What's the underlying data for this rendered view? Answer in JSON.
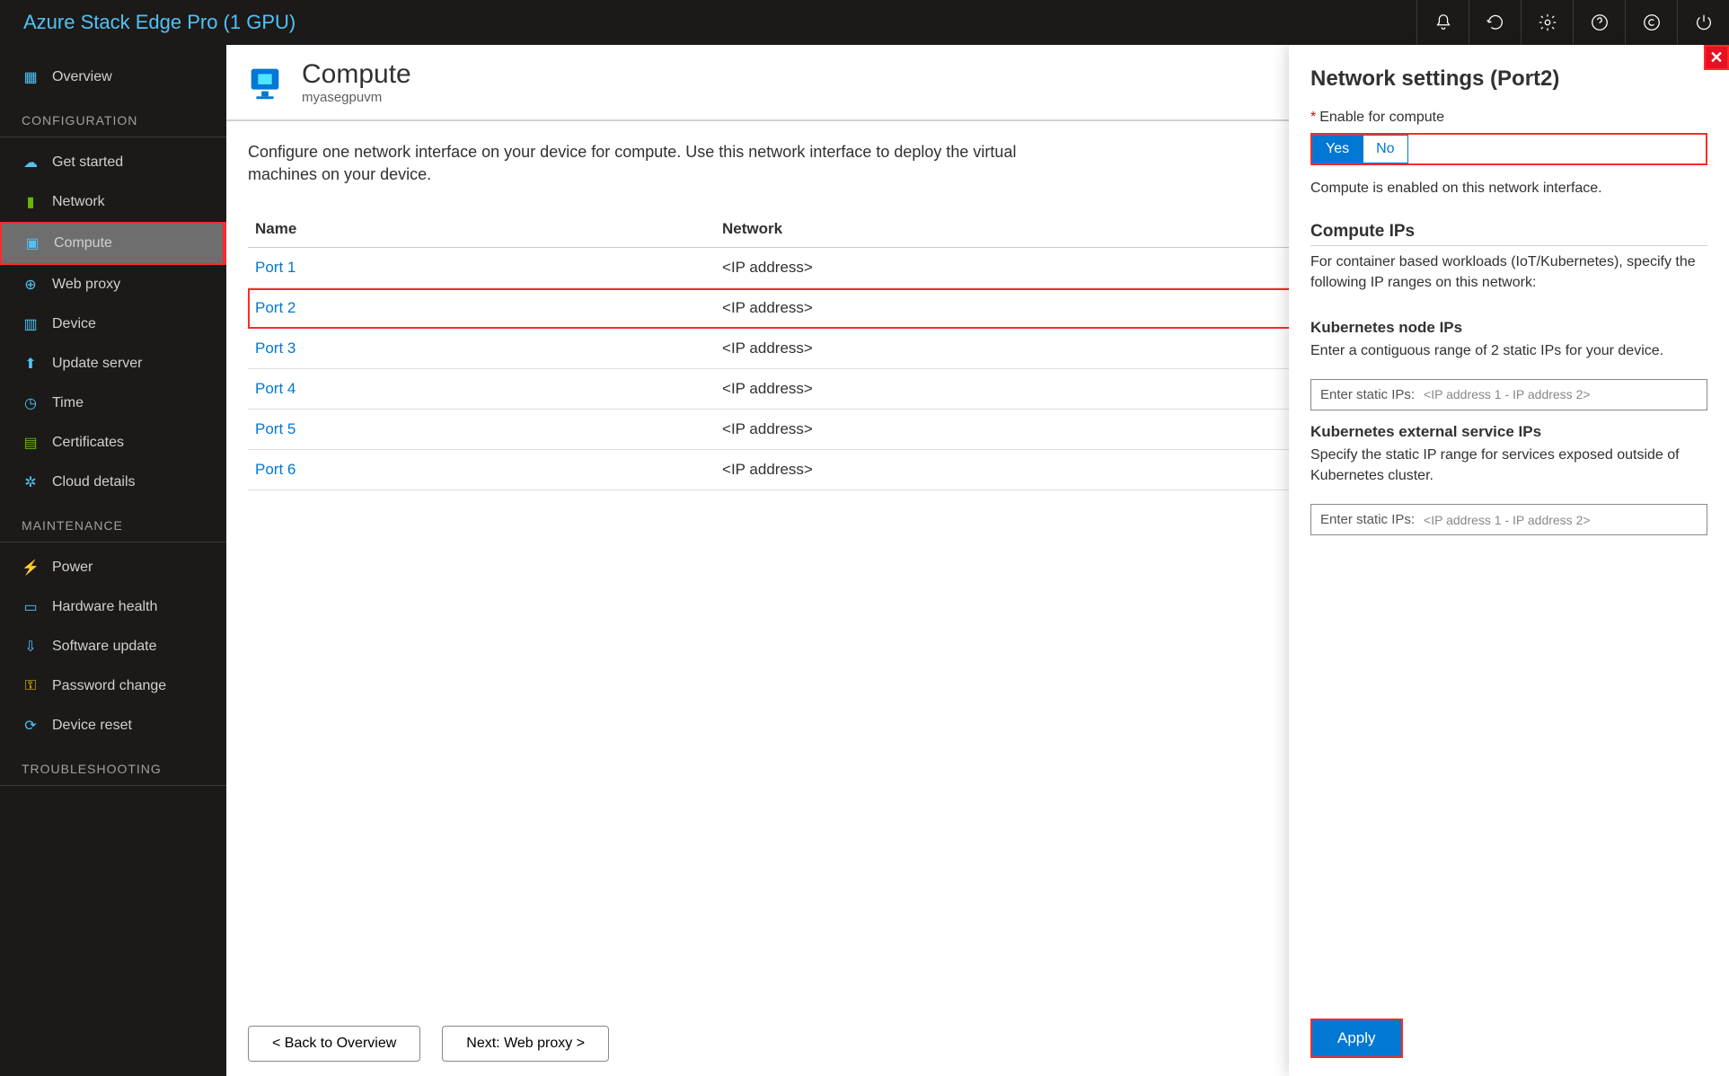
{
  "app_title": "Azure Stack Edge Pro (1 GPU)",
  "sidebar": {
    "overview": "Overview",
    "sections": {
      "config": {
        "label": "CONFIGURATION",
        "items": [
          {
            "label": "Get started"
          },
          {
            "label": "Network"
          },
          {
            "label": "Compute"
          },
          {
            "label": "Web proxy"
          },
          {
            "label": "Device"
          },
          {
            "label": "Update server"
          },
          {
            "label": "Time"
          },
          {
            "label": "Certificates"
          },
          {
            "label": "Cloud details"
          }
        ]
      },
      "maint": {
        "label": "MAINTENANCE",
        "items": [
          {
            "label": "Power"
          },
          {
            "label": "Hardware health"
          },
          {
            "label": "Software update"
          },
          {
            "label": "Password change"
          },
          {
            "label": "Device reset"
          }
        ]
      },
      "trouble": {
        "label": "TROUBLESHOOTING"
      }
    }
  },
  "page": {
    "title": "Compute",
    "subtitle": "myasegpuvm",
    "intro": "Configure one network interface on your device for compute. Use this network interface to deploy the virtual machines on your device.",
    "table": {
      "col_name": "Name",
      "col_network": "Network",
      "rows": [
        {
          "name": "Port 1",
          "net": "<IP address>"
        },
        {
          "name": "Port 2",
          "net": "<IP address>"
        },
        {
          "name": "Port 3",
          "net": "<IP address>"
        },
        {
          "name": "Port 4",
          "net": "<IP address>"
        },
        {
          "name": "Port 5",
          "net": "<IP address>"
        },
        {
          "name": "Port 6",
          "net": "<IP address>"
        }
      ]
    },
    "back_btn": "< Back to Overview",
    "next_btn": "Next: Web proxy >"
  },
  "panel": {
    "title": "Network settings (Port2)",
    "enable_label": "Enable for compute",
    "yes": "Yes",
    "no": "No",
    "enabled_text": "Compute is enabled on this network interface.",
    "compute_ips_h": "Compute IPs",
    "compute_ips_p": "For container based workloads (IoT/Kubernetes), specify the following IP ranges on this network:",
    "k8s_node_h": "Kubernetes node IPs",
    "k8s_node_p": "Enter a contiguous range of 2 static IPs for your device.",
    "k8s_svc_h": "Kubernetes external service IPs",
    "k8s_svc_p": "Specify the static IP range for services exposed outside of Kubernetes cluster.",
    "ip_input_label": "Enter static IPs:",
    "ip_input_ph": "<IP address 1 - IP address 2>",
    "apply": "Apply"
  },
  "colors": {
    "accent": "#0078d4",
    "highlight": "#ff2a2a",
    "bg_dark": "#1b1a19"
  }
}
